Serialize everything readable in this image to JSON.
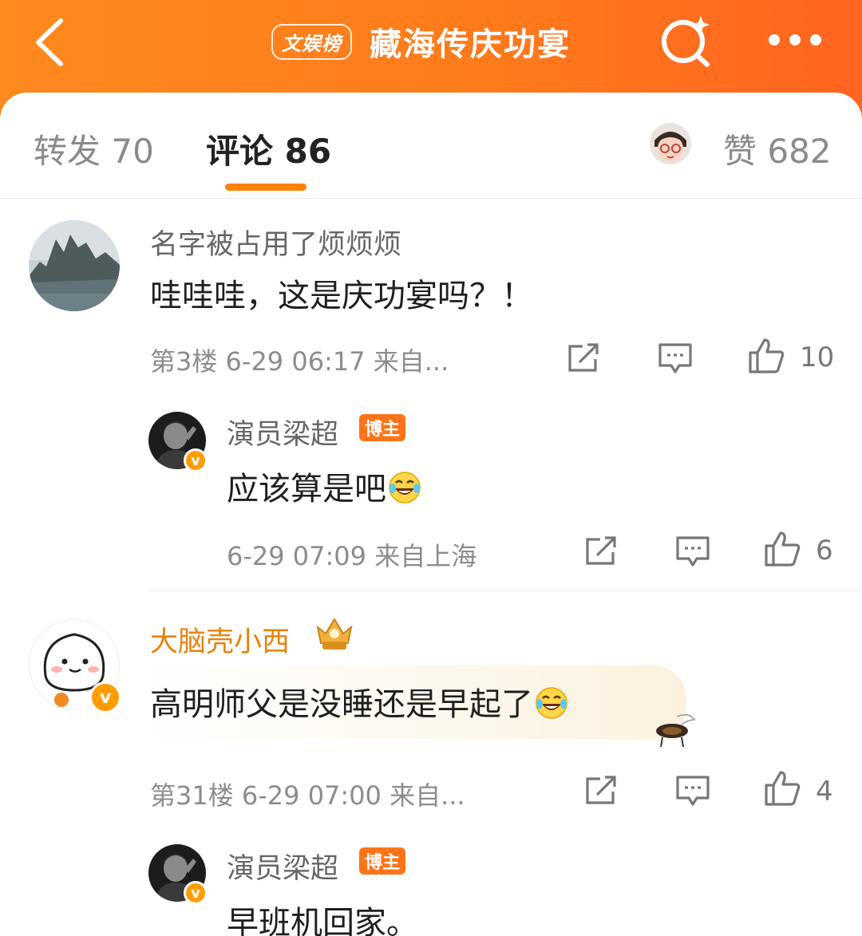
{
  "header": {
    "badge": "文娱榜",
    "title": "藏海传庆功宴"
  },
  "tabs": [
    {
      "label": "转发 70"
    },
    {
      "label": "评论 86"
    },
    {
      "label": "赞 682"
    }
  ],
  "comments": [
    {
      "name": "名字被占用了烦烦烦",
      "text": "哇哇哇，这是庆功宴吗？！",
      "meta": "第3楼 6-29 06:17 来自...",
      "likes": "10",
      "reply": {
        "name": "演员梁超",
        "tag": "博主",
        "text": "应该算是吧",
        "meta": "6-29 07:09 来自上海",
        "likes": "6"
      }
    },
    {
      "name": "大脑壳小西",
      "text": "高明师父是没睡还是早起了",
      "meta": "第31楼 6-29 07:00 来自...",
      "likes": "4",
      "reply": {
        "name": "演员梁超",
        "tag": "博主",
        "text": "早班机回家。"
      }
    }
  ],
  "colors": {
    "brand_orange": "#ff7b1b",
    "tab_indicator": "#ff8200",
    "vip_name": "#e6820a",
    "verified_badge": "#ff9d00"
  },
  "icons": [
    "back-icon",
    "search-icon",
    "more-icon",
    "share-icon",
    "comment-icon",
    "like-icon",
    "verified-icon",
    "crown-badge-icon",
    "laugh-cry-emoji"
  ]
}
